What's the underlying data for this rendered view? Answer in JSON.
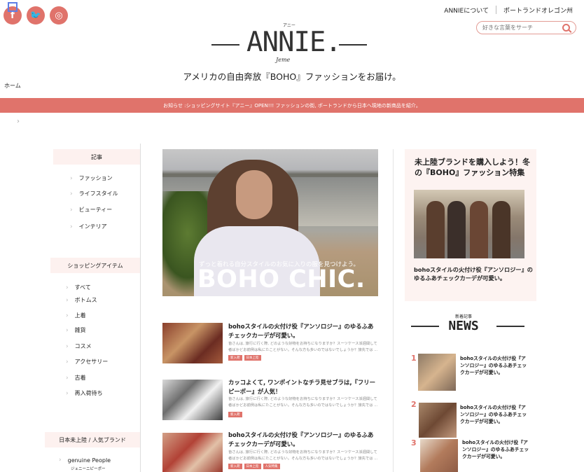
{
  "social": [
    {
      "name": "facebook-icon",
      "glyph": "f"
    },
    {
      "name": "twitter-icon",
      "glyph": "🐦"
    },
    {
      "name": "instagram-icon",
      "glyph": "◎"
    }
  ],
  "header": {
    "links": [
      "ANNIEについて",
      "ポートランドオレゴン州"
    ],
    "search_placeholder": "好きな言葉をサーチ",
    "logo_ruby": "アニー",
    "logo": "ANNIE.",
    "logo_sub": "Jeme",
    "tagline": "アメリカの自由奔放『BOHO』ファッションをお届け。"
  },
  "breadcrumb": {
    "home": "ホーム",
    "chevron": "›"
  },
  "notice": "お知らせ :ショッピングサイト『アニー』OPEN!!! ファッションの街, ポートランドから日本へ現地の新商品を紹介。",
  "sidebar": {
    "sections": [
      {
        "title": "記事",
        "items": [
          "ファッション",
          "ライフスタイル",
          "ビューティー",
          "インテリア"
        ]
      },
      {
        "title": "ショッピングアイテム",
        "items": [
          "すべて",
          "ボトムス",
          "上着",
          "雑貨",
          "コスメ",
          "アクセサリー",
          "古着",
          "再入荷待ち"
        ]
      },
      {
        "title": "日本未上陸 / 人気ブランド",
        "items": [
          "genuine People"
        ],
        "sub": "ジェニーニピーポー"
      }
    ]
  },
  "hero": {
    "subtitle": "ずっと着れる自分スタイルのお気に入りの服を見つけよう。",
    "title": "BOHO CHIC."
  },
  "articles": [
    {
      "title": "bohoスタイルの火付け役『アンソロジー』のゆるふあチェックカーデが可愛い。",
      "desc": "皆さんは, 旅行に行く際, どのような好物をお持ちになりますか？スーツケース派週間して者ばかどお前例は私にたことがない。そんな方も多いのではないでしょうか？旅先では ...",
      "tags": [
        "新入荷",
        "日本上陸"
      ]
    },
    {
      "title": "カッコよくて, ワンポイントなチラ見せブラは,『フリーピーポー』が人気！",
      "desc": "皆さんは, 旅行に行く際, どのような好物をお持ちになりますか？スーツケース派週間して者ばかどお前例は私にたことがない。そんな方も多いのではないでしょうか？旅先では ...",
      "tags": [
        "新入荷"
      ]
    },
    {
      "title": "bohoスタイルの火付け役『アンソロジー』のゆるふあチェックカーデが可愛い。",
      "desc": "皆さんは, 旅行に行く際, どのような好物をお持ちになりますか？スーツケース派週間して者ばかどお前例は私にたことがない。そんな方も多いのではないでしょうか？旅先では ...",
      "tags": [
        "新入荷",
        "日本上陸",
        "人気特集"
      ]
    }
  ],
  "feature": {
    "title": "未上陸ブランドを購入しよう！冬の『BOHO』ファッション特集",
    "desc": "bohoスタイルの火付け役『アンソロジー』のゆるふあチェックカーデが可愛い。"
  },
  "news": {
    "ruby": "新着記事",
    "title": "NEWS",
    "items": [
      {
        "rank": "1",
        "title": "bohoスタイルの火付け役『アンソロジー』のゆるふあチェックカーデが可愛い。"
      },
      {
        "rank": "2",
        "title": "bohoスタイルの火付け役『アンソロジー』のゆるふあチェックカーデが可愛い。"
      },
      {
        "rank": "3",
        "title": "bohoスタイルの火付け役『アンソロジー』のゆるふあチェックカーデが可愛い。"
      }
    ]
  },
  "colors": {
    "accent": "#e0736b",
    "panel": "#fdf1ef"
  }
}
